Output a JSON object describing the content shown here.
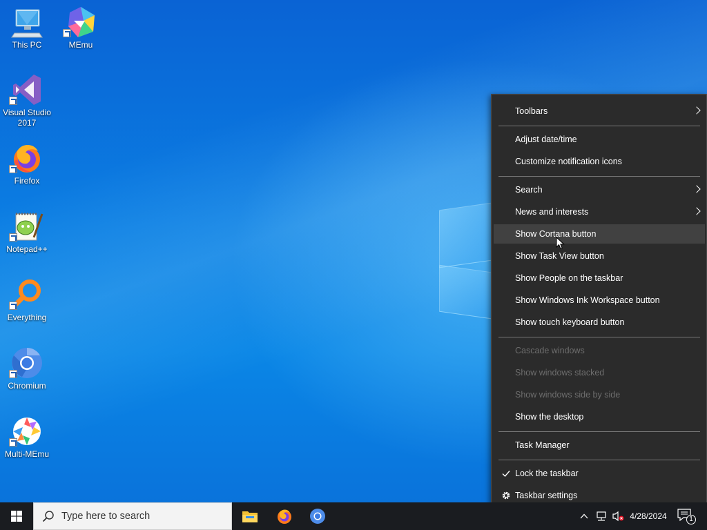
{
  "desktop": {
    "icons": [
      {
        "name": "this-pc",
        "label": "This PC"
      },
      {
        "name": "memu",
        "label": "MEmu"
      },
      {
        "name": "visual-studio",
        "label": "Visual Studio 2017"
      },
      {
        "name": "firefox",
        "label": "Firefox"
      },
      {
        "name": "notepadpp",
        "label": "Notepad++"
      },
      {
        "name": "everything",
        "label": "Everything"
      },
      {
        "name": "chromium",
        "label": "Chromium"
      },
      {
        "name": "multi-memu",
        "label": "Multi-MEmu"
      }
    ]
  },
  "context_menu": {
    "items": [
      {
        "label": "Toolbars",
        "submenu": true
      },
      {
        "label": "Adjust date/time"
      },
      {
        "label": "Customize notification icons"
      },
      {
        "label": "Search",
        "submenu": true
      },
      {
        "label": "News and interests",
        "submenu": true
      },
      {
        "label": "Show Cortana button",
        "highlighted": true
      },
      {
        "label": "Show Task View button"
      },
      {
        "label": "Show People on the taskbar"
      },
      {
        "label": "Show Windows Ink Workspace button"
      },
      {
        "label": "Show touch keyboard button"
      },
      {
        "label": "Cascade windows",
        "disabled": true
      },
      {
        "label": "Show windows stacked",
        "disabled": true
      },
      {
        "label": "Show windows side by side",
        "disabled": true
      },
      {
        "label": "Show the desktop"
      },
      {
        "label": "Task Manager"
      },
      {
        "label": "Lock the taskbar",
        "checked": true
      },
      {
        "label": "Taskbar settings",
        "icon": "gear-icon"
      }
    ]
  },
  "taskbar": {
    "search_placeholder": "Type here to search",
    "pinned": [
      "file-explorer-icon",
      "firefox-icon",
      "chromium-icon"
    ],
    "date": "4/28/2024",
    "notification_count": "1"
  },
  "colors": {
    "menu_bg": "#2b2b2b",
    "menu_highlight": "#414141",
    "taskbar_bg": "#1a1c20",
    "wallpaper": "#0a6fd8"
  }
}
